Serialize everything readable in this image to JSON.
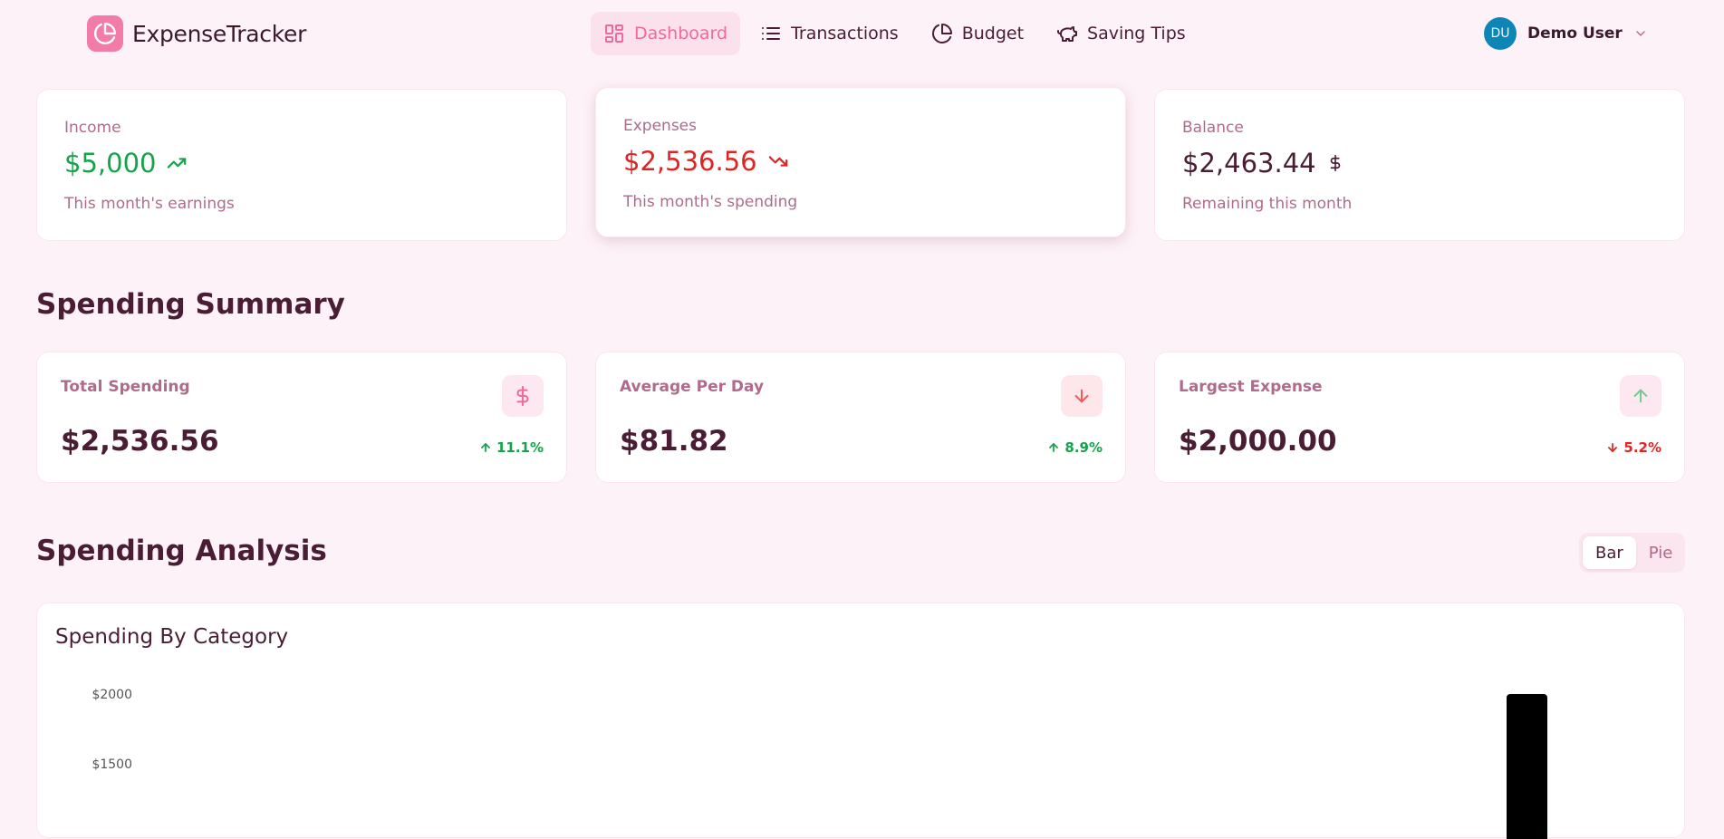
{
  "app": {
    "name": "ExpenseTracker"
  },
  "nav": [
    {
      "label": "Dashboard",
      "icon": "dashboard-icon",
      "active": true
    },
    {
      "label": "Transactions",
      "icon": "list-icon",
      "active": false
    },
    {
      "label": "Budget",
      "icon": "pie-chart-icon",
      "active": false
    },
    {
      "label": "Saving Tips",
      "icon": "piggy-bank-icon",
      "active": false
    }
  ],
  "user": {
    "initials": "DU",
    "name": "Demo User"
  },
  "stats": {
    "income": {
      "label": "Income",
      "value": "$5,000",
      "note": "This month's earnings",
      "color": "#16a34a"
    },
    "expenses": {
      "label": "Expenses",
      "value": "$2,536.56",
      "note": "This month's spending",
      "color": "#dc2626"
    },
    "balance": {
      "label": "Balance",
      "value": "$2,463.44",
      "note": "Remaining this month",
      "color": "#4a1d34"
    }
  },
  "spending_summary": {
    "title": "Spending Summary",
    "cards": [
      {
        "label": "Total Spending",
        "value": "$2,536.56",
        "change": "11.1%",
        "direction": "up",
        "icon": "dollar-icon",
        "change_color": "#16a34a"
      },
      {
        "label": "Average Per Day",
        "value": "$81.82",
        "change": "8.9%",
        "direction": "up",
        "icon": "arrow-down-icon",
        "change_color": "#16a34a"
      },
      {
        "label": "Largest Expense",
        "value": "$2,000.00",
        "change": "5.2%",
        "direction": "down",
        "icon": "arrow-up-icon",
        "change_color": "#dc2626"
      }
    ]
  },
  "spending_analysis": {
    "title": "Spending Analysis",
    "toggle": {
      "options": [
        "Bar",
        "Pie"
      ],
      "selected": "Bar"
    },
    "chart_title": "Spending By Category"
  },
  "chart_data": {
    "type": "bar",
    "title": "Spending By Category",
    "ytick_labels": [
      "$2000",
      "$1500"
    ],
    "yticks": [
      2000,
      1500
    ],
    "visible_bars": [
      {
        "value": 2000,
        "color": "#000000"
      }
    ]
  }
}
